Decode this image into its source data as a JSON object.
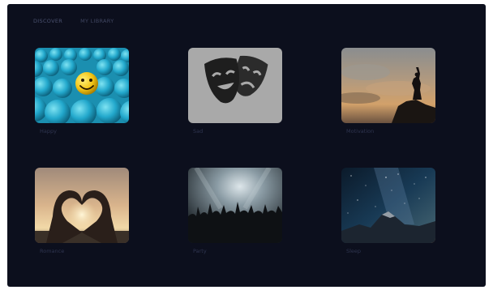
{
  "nav": {
    "tabs": [
      {
        "label": "DISCOVER"
      },
      {
        "label": "MY LIBRARY"
      }
    ]
  },
  "moods": [
    {
      "label": "Happy",
      "image": "smiley-emoji-crowd"
    },
    {
      "label": "Sad",
      "image": "theater-masks"
    },
    {
      "label": "Motivation",
      "image": "climber-summit-silhouette"
    },
    {
      "label": "Romance",
      "image": "heart-hands-sunset"
    },
    {
      "label": "Party",
      "image": "concert-crowd"
    },
    {
      "label": "Sleep",
      "image": "night-sky-mountain"
    }
  ],
  "colors": {
    "background": "#0c0f1d",
    "nav_text": "#3f4560",
    "label_text": "#2f3550"
  }
}
